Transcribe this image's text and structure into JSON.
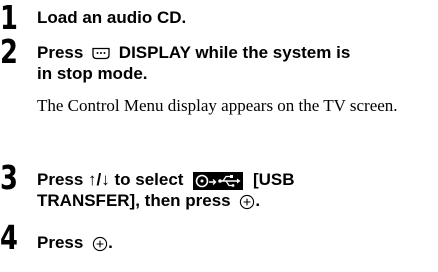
{
  "steps": [
    {
      "number": "1",
      "line1": "Load an audio CD."
    },
    {
      "number": "2",
      "line1_before": "Press",
      "display_icon": "display-button-icon",
      "line1_after": "DISPLAY while the system is",
      "line2": "in stop mode.",
      "description": "The Control Menu display appears on the TV screen."
    },
    {
      "number": "3",
      "line1_before": "Press ↑/↓ to select",
      "transfer_icon": "usb-transfer-icon",
      "line1_after": "[USB",
      "line2_before": "TRANSFER], then press",
      "enter_icon": "enter-button-icon",
      "line2_after": "."
    },
    {
      "number": "4",
      "line1_before": "Press",
      "enter_icon": "enter-button-icon",
      "line1_after": "."
    }
  ]
}
